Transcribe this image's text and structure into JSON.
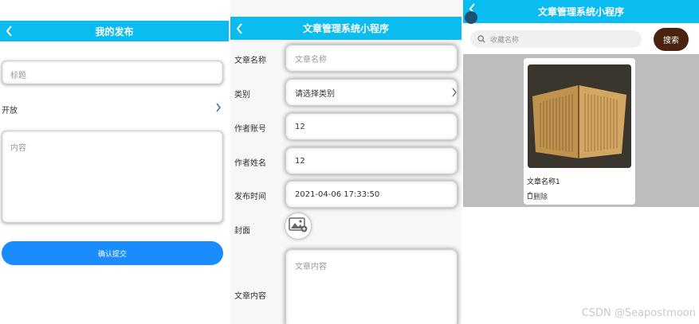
{
  "panel1": {
    "title": "我的发布",
    "title_placeholder": "标题",
    "open_label": "开放",
    "content_placeholder": "内容",
    "submit_label": "确认提交"
  },
  "panel2": {
    "title": "文章管理系统小程序",
    "fields": [
      {
        "label": "文章名称",
        "placeholder": "文章名称"
      },
      {
        "label": "类别",
        "value": "请选择类别"
      },
      {
        "label": "作者账号",
        "value": "12"
      },
      {
        "label": "作者姓名",
        "value": "12"
      },
      {
        "label": "发布时间",
        "value": "2021-04-06 17:33:50"
      },
      {
        "label": "封面"
      },
      {
        "label": "文章内容",
        "placeholder": "文章内容"
      }
    ]
  },
  "panel3": {
    "title": "文章管理系统小程序",
    "search_placeholder": "收藏名称",
    "search_button": "搜索",
    "items": [
      {
        "title": "文章名称1",
        "delete_label": "删除"
      }
    ]
  },
  "watermark": "CSDN @Seapostmoon",
  "colors": {
    "navbar": "#0bbcf1",
    "submit_button": "#1a8cff",
    "search_button": "#4a2210"
  },
  "icons": [
    "back-arrow-icon",
    "chevron-right-icon",
    "image-placeholder-icon",
    "search-icon",
    "trash-icon"
  ]
}
